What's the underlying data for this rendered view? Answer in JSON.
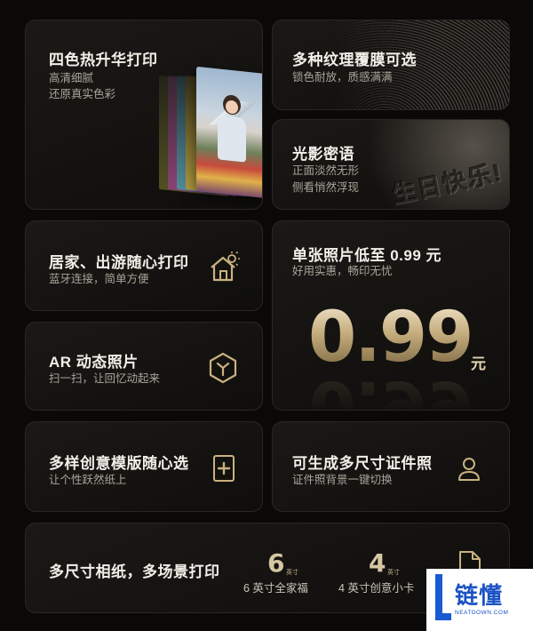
{
  "cards": {
    "four_color": {
      "title": "四色热升华打印",
      "sub1": "高清细腻",
      "sub2": "还原真实色彩"
    },
    "texture": {
      "title": "多种纹理覆膜可选",
      "sub1": "锁色耐放，质感满满"
    },
    "light": {
      "title": "光影密语",
      "sub1": "正面淡然无形",
      "sub2": "侧看悄然浮现",
      "emboss": "生日快乐!"
    },
    "home": {
      "title": "居家、出游随心打印",
      "sub1": "蓝牙连接，简单方便"
    },
    "price": {
      "title": "单张照片低至 0.99 元",
      "sub1": "好用实惠，畅印无忧",
      "big": "0.99",
      "unit": "元"
    },
    "ar": {
      "title": "AR 动态照片",
      "sub1": "扫一扫，让回忆动起来"
    },
    "template": {
      "title": "多样创意模版随心选",
      "sub1": "让个性跃然纸上"
    },
    "idphoto": {
      "title": "可生成多尺寸证件照",
      "sub1": "证件照背景一键切换"
    },
    "sizes": {
      "title": "多尺寸相纸，多场景打印",
      "items": [
        {
          "num": "6",
          "unit": "英寸",
          "label": "6 英寸全家福"
        },
        {
          "num": "4",
          "unit": "英寸",
          "label": "4 英寸创意小卡"
        }
      ]
    }
  },
  "logo": {
    "text": "链懂",
    "sub": "NEATDOWN.COM"
  },
  "colors": {
    "gold": "#d7c7a3",
    "bg": "#0a0908",
    "logo_blue": "#1a5bd1"
  },
  "icons": [
    "house-sun-icon",
    "ar-hexagon-icon",
    "template-plus-icon",
    "person-id-icon",
    "document-icon"
  ]
}
